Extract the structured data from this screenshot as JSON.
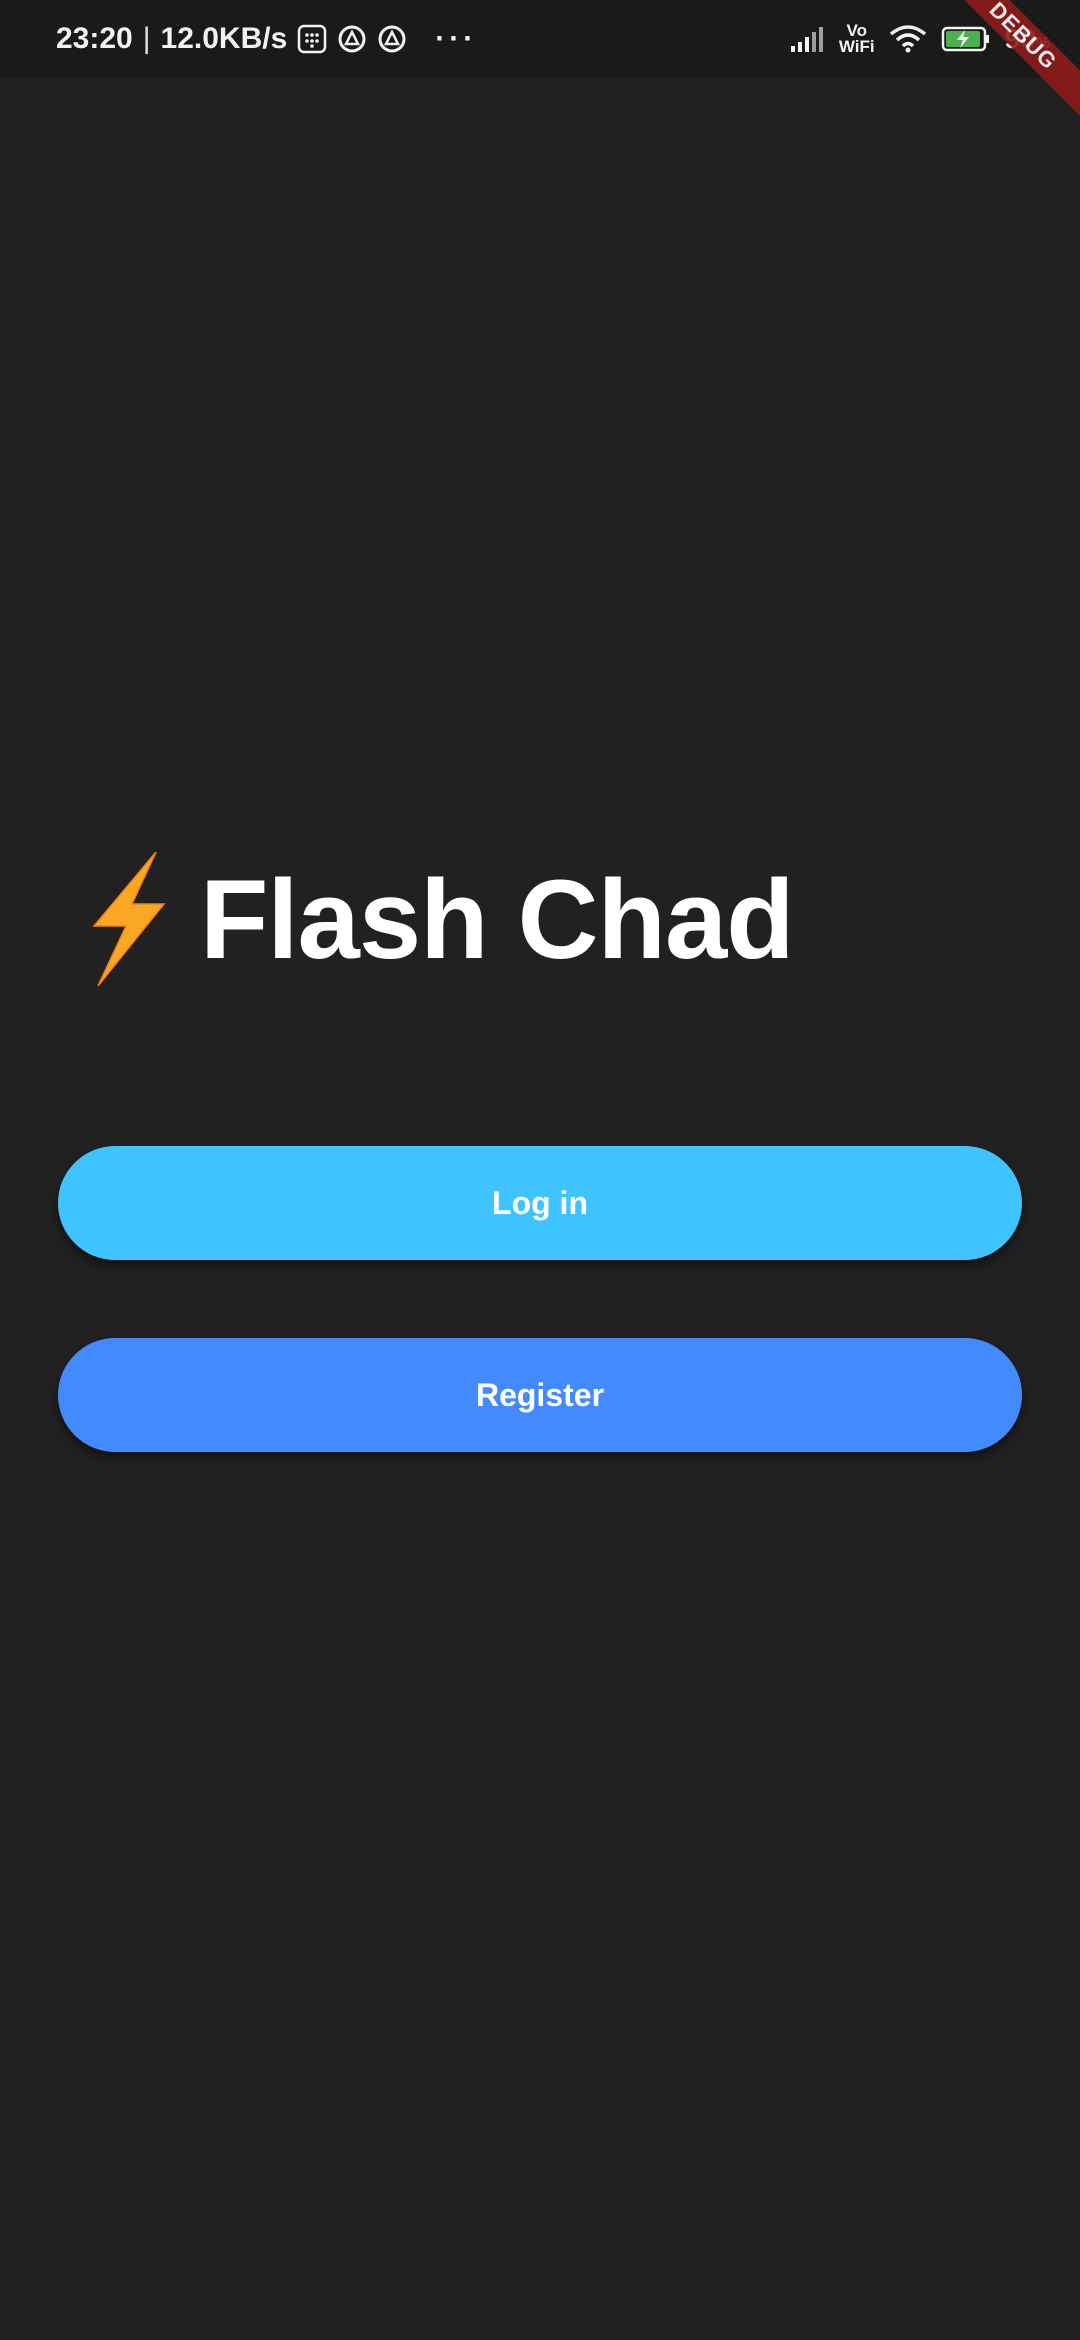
{
  "status_bar": {
    "time": "23:20",
    "separator": "|",
    "net_speed": "12.0KB/s",
    "more": "···",
    "vowifi_top": "Vo",
    "vowifi_bottom": "WiFi",
    "battery_percent": "90",
    "battery_unit": "%",
    "icons": [
      "notification-grid-icon",
      "app-notification-icon",
      "app-notification-icon",
      "signal-icon",
      "wifi-icon",
      "battery-charging-icon"
    ]
  },
  "debug_banner": "DEBUG",
  "app": {
    "logo_icon": "lightning-bolt-icon",
    "title": "Flash Chad"
  },
  "buttons": {
    "login_label": "Log in",
    "register_label": "Register"
  },
  "colors": {
    "background": "#212121",
    "login_button": "#40c4ff",
    "register_button": "#448aff",
    "bolt": "#f9a825",
    "debug_banner": "#8e1a1a"
  }
}
